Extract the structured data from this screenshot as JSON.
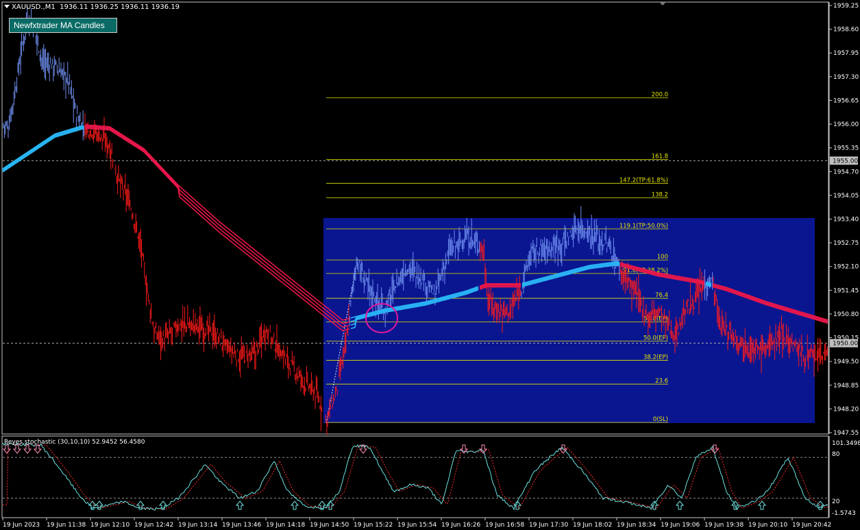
{
  "header": {
    "symbol": "XAUUSD.,M1",
    "ohlc": "1936.11 1936.25 1936.11 1936.19"
  },
  "badge": {
    "label": "Newfxtrader MA Candles"
  },
  "colors": {
    "bull": "#6f8ff0",
    "bear": "#ff1a1a",
    "ma_up": "#29b6f6",
    "ma_down": "#e8174a",
    "fib": "#e6e600",
    "rect": "#0a1690",
    "circle": "#e0189d",
    "stoch_main": "#6fe3e3",
    "stoch_signal": "#ff2a2a",
    "arrow_up": "#6fe3e3",
    "arrow_down": "#ff8fb8"
  },
  "price_axis": {
    "labels": [
      "1959.25",
      "1958.60",
      "1957.95",
      "1957.30",
      "1956.65",
      "1956.00",
      "1955.35",
      "1954.70",
      "1954.05",
      "1953.40",
      "1952.75",
      "1952.10",
      "1951.45",
      "1950.80",
      "1950.15",
      "1949.50",
      "1948.85",
      "1948.20",
      "1947.55"
    ],
    "current_a": "1955.00",
    "current_b": "1950.00"
  },
  "time_axis": {
    "labels": [
      "19 Jun 2023",
      "19 Jun 11:38",
      "19 Jun 12:10",
      "19 Jun 12:42",
      "19 Jun 13:14",
      "19 Jun 13:46",
      "19 Jun 14:18",
      "19 Jun 14:50",
      "19 Jun 15:22",
      "19 Jun 15:54",
      "19 Jun 16:26",
      "19 Jun 16:58",
      "19 Jun 17:30",
      "19 Jun 18:02",
      "19 Jun 18:34",
      "19 Jun 19:06",
      "19 Jun 19:38",
      "19 Jun 20:10",
      "19 Jun 20:42"
    ]
  },
  "fibonacci": {
    "levels": [
      {
        "label": "200.0",
        "price": 1956.72
      },
      {
        "label": "161.8",
        "price": 1955.03
      },
      {
        "label": "147.2(TP:61.8%)",
        "price": 1954.38
      },
      {
        "label": "138.2",
        "price": 1953.98
      },
      {
        "label": "119.1(TP:50.0%)",
        "price": 1953.13
      },
      {
        "label": "100",
        "price": 1952.28
      },
      {
        "label": "91.6(TP:38.2%)",
        "price": 1951.91
      },
      {
        "label": "76.4",
        "price": 1951.23
      },
      {
        "label": "61.8(EP)",
        "price": 1950.58
      },
      {
        "label": "50.0(EP)",
        "price": 1950.06
      },
      {
        "label": "38.2(EP)",
        "price": 1949.53
      },
      {
        "label": "23.6",
        "price": 1948.88
      },
      {
        "label": "0(SL)",
        "price": 1947.83
      }
    ]
  },
  "indicator": {
    "title": "Reyes stochastic (30,10,10) 52.9452 56.4580",
    "levels": [
      "101.3498",
      "80",
      "20",
      "-1.5743"
    ],
    "level_values": [
      80,
      20
    ]
  }
}
